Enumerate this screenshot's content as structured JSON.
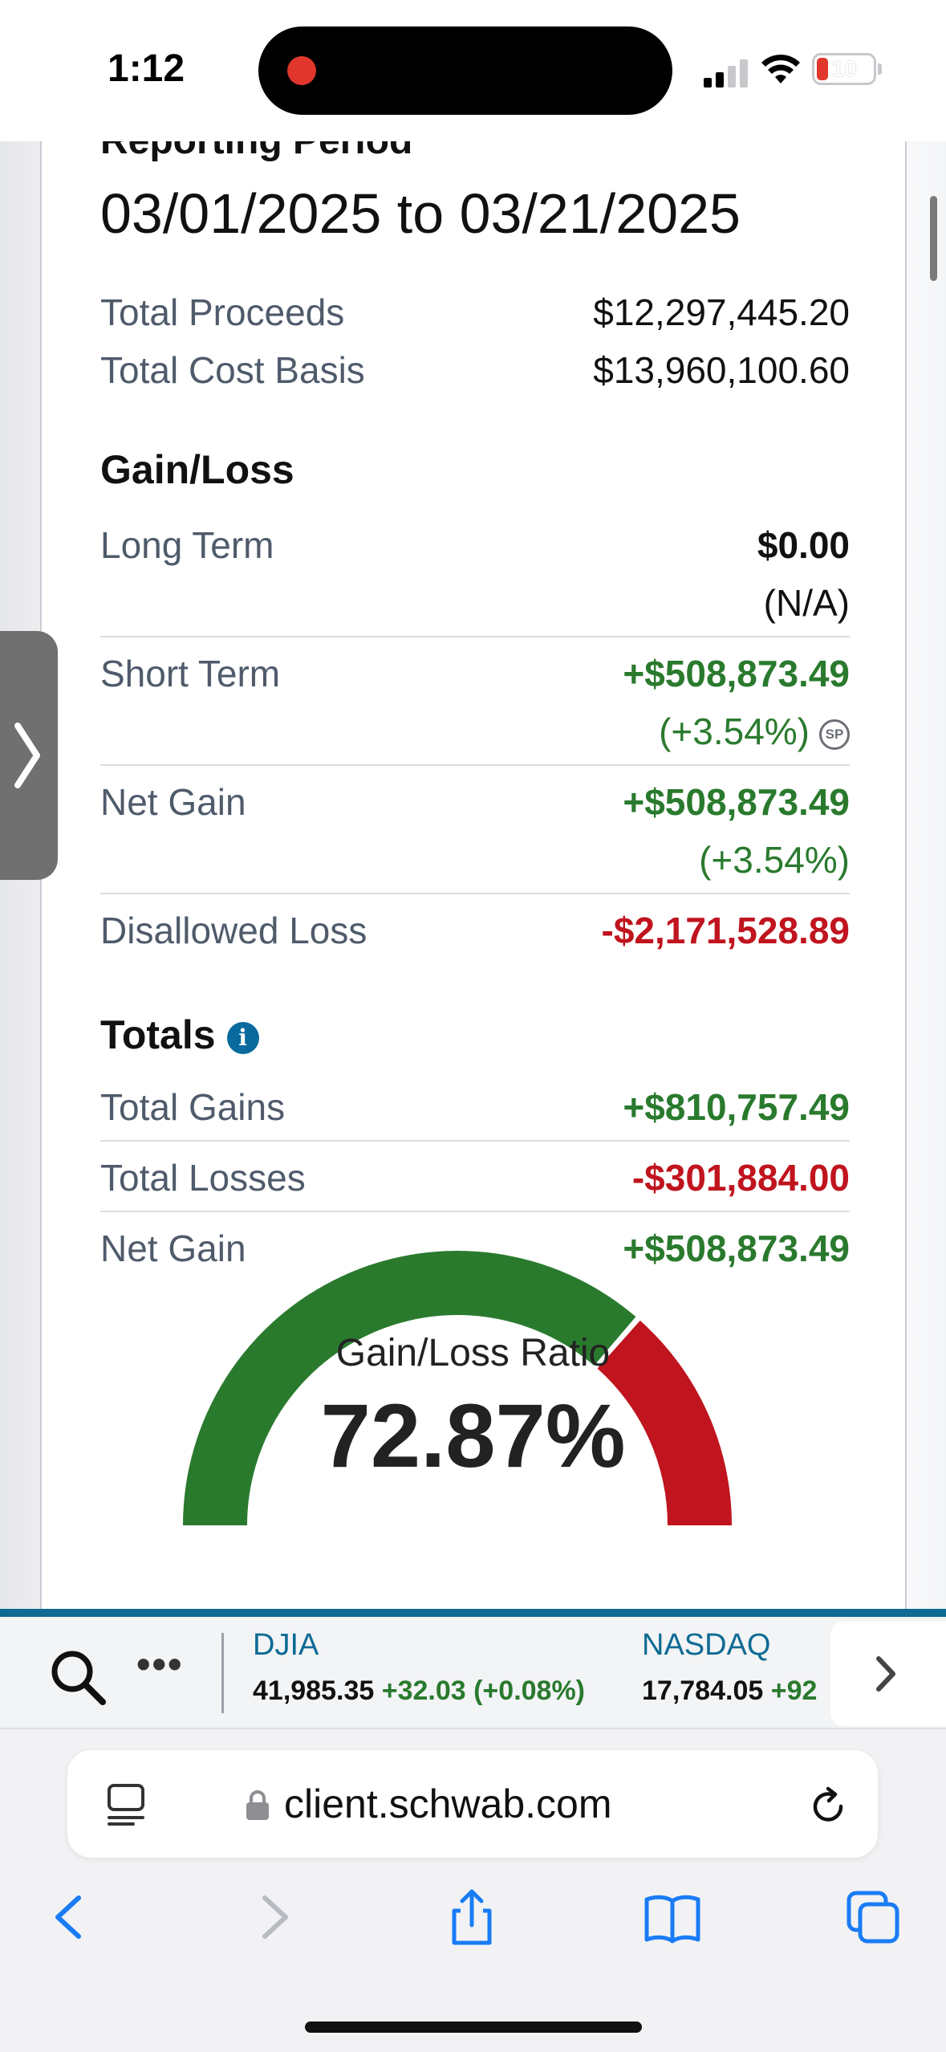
{
  "status_bar": {
    "time": "1:12",
    "battery": "10"
  },
  "report": {
    "period_label": "Reporting Period",
    "period_value": "03/01/2025 to 03/21/2025",
    "total_proceeds_label": "Total Proceeds",
    "total_proceeds_value": "$12,297,445.20",
    "total_cost_basis_label": "Total Cost Basis",
    "total_cost_basis_value": "$13,960,100.60"
  },
  "gain_loss": {
    "title": "Gain/Loss",
    "long_term_label": "Long Term",
    "long_term_value": "$0.00",
    "long_term_pct": "(N/A)",
    "short_term_label": "Short Term",
    "short_term_value": "+$508,873.49",
    "short_term_pct": "(+3.54%)",
    "sp_badge": "SP",
    "net_gain_label": "Net Gain",
    "net_gain_value": "+$508,873.49",
    "net_gain_pct": "(+3.54%)",
    "disallowed_label": "Disallowed Loss",
    "disallowed_value": "-$2,171,528.89"
  },
  "totals": {
    "title": "Totals",
    "info_icon": "i",
    "total_gains_label": "Total Gains",
    "total_gains_value": "+$810,757.49",
    "total_losses_label": "Total Losses",
    "total_losses_value": "-$301,884.00",
    "net_gain_label": "Net Gain",
    "net_gain_value": "+$508,873.49"
  },
  "chart_data": {
    "type": "pie",
    "categories": [
      "Gains",
      "Losses"
    ],
    "values": [
      810757.49,
      301884.0
    ],
    "colors": [
      "#2a7a2e",
      "#c0141e"
    ],
    "title": "Gain/Loss Ratio",
    "center_value": "72.87%"
  },
  "ticker": {
    "items": [
      {
        "name": "DJIA",
        "value": "41,985.35",
        "change": "+32.03 (+0.08%)"
      },
      {
        "name": "NASDAQ",
        "value": "17,784.05",
        "change": "+92"
      }
    ]
  },
  "browser": {
    "url": "client.schwab.com"
  },
  "colors": {
    "accent": "#0e6b94",
    "positive": "#2a7a2e",
    "negative": "#c0141e"
  }
}
